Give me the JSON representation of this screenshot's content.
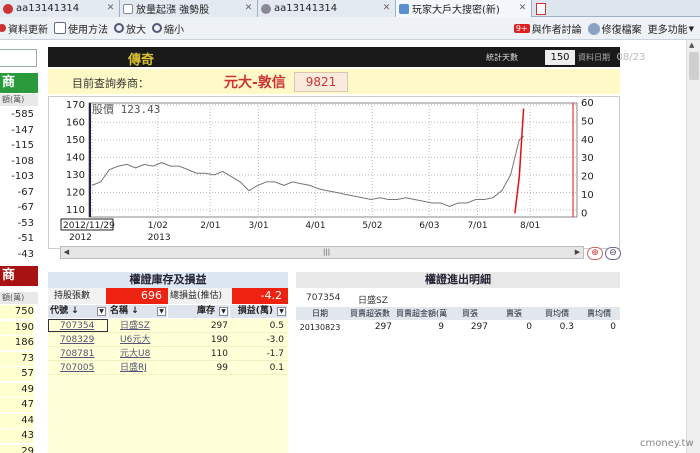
{
  "tabs": [
    {
      "label": "aa13141314",
      "active": false
    },
    {
      "label": "放量起漲 強勢股",
      "active": false
    },
    {
      "label": "aa13141314",
      "active": false
    },
    {
      "label": "玩家大戶大搜密(新)",
      "active": true
    }
  ],
  "toolbar": {
    "refresh": "資料更新",
    "help": "使用方法",
    "zoom_in": "放大",
    "zoom_out": "縮小",
    "badge": "9+",
    "discuss": "與作者討論",
    "repair": "修復檔案",
    "more": "更多功能"
  },
  "left": {
    "head1": "商",
    "sub1": "額(萬)",
    "vals1": [
      "-585",
      "-147",
      "-115",
      "-108",
      "-103",
      "-67",
      "-67",
      "-53",
      "-51",
      "-43"
    ],
    "head2": "商",
    "sub2": "額(萬)",
    "vals2": [
      "750",
      "190",
      "186",
      "73",
      "57",
      "49",
      "47",
      "44",
      "43",
      "29"
    ]
  },
  "header": {
    "title": "傳奇",
    "stat_label": "統計天數",
    "stat_value": "150",
    "date_label": "資料日期",
    "date_value": "08/23"
  },
  "query": {
    "label": "目前查詢券商：",
    "broker": "元大-敦信",
    "code": "9821"
  },
  "chart_data": {
    "type": "line",
    "title": "股價 123.43",
    "x_ticks": [
      "2012/11/29",
      "1/02",
      "2/01",
      "3/01",
      "4/01",
      "5/02",
      "6/03",
      "7/01",
      "8/01"
    ],
    "year_labels": [
      "2012",
      "2013"
    ],
    "y_left_ticks": [
      110,
      120,
      130,
      140,
      150,
      160,
      170
    ],
    "y_left_range": [
      106,
      171
    ],
    "y_right_ticks": [
      0,
      10,
      20,
      30,
      40,
      50,
      60
    ],
    "y_right_range": [
      -2,
      60
    ],
    "price_series": [
      [
        0,
        124
      ],
      [
        2,
        126
      ],
      [
        4,
        133
      ],
      [
        6,
        135
      ],
      [
        8,
        136
      ],
      [
        10,
        134
      ],
      [
        12,
        136
      ],
      [
        14,
        135
      ],
      [
        16,
        137
      ],
      [
        18,
        135
      ],
      [
        20,
        135
      ],
      [
        22,
        133
      ],
      [
        24,
        131
      ],
      [
        26,
        131
      ],
      [
        28,
        130
      ],
      [
        30,
        132
      ],
      [
        32,
        129
      ],
      [
        34,
        126
      ],
      [
        36,
        121
      ],
      [
        38,
        124
      ],
      [
        40,
        126
      ],
      [
        42,
        126
      ],
      [
        44,
        124
      ],
      [
        46,
        126
      ],
      [
        48,
        125
      ],
      [
        50,
        124
      ],
      [
        52,
        122
      ],
      [
        54,
        121
      ],
      [
        56,
        120
      ],
      [
        58,
        119
      ],
      [
        60,
        118
      ],
      [
        62,
        117
      ],
      [
        64,
        116
      ],
      [
        66,
        117
      ],
      [
        68,
        116
      ],
      [
        70,
        116
      ],
      [
        72,
        117
      ],
      [
        74,
        116
      ],
      [
        76,
        115
      ],
      [
        78,
        114
      ],
      [
        80,
        114
      ],
      [
        82,
        112
      ],
      [
        84,
        114
      ],
      [
        86,
        114
      ],
      [
        88,
        116
      ],
      [
        90,
        116
      ],
      [
        92,
        117
      ],
      [
        94,
        121
      ],
      [
        96,
        130
      ],
      [
        97,
        140
      ],
      [
        98,
        150
      ],
      [
        99,
        152
      ]
    ],
    "inventory_series": [
      [
        97,
        0
      ],
      [
        98,
        20
      ],
      [
        99,
        57
      ]
    ]
  },
  "inventory": {
    "title": "權證庫存及損益",
    "holdings_label": "持股張數",
    "holdings_value": "696",
    "pnl_label": "總損益(推估)",
    "pnl_value": "-4.2",
    "columns": [
      "代號 ↓",
      "名稱 ↓",
      "庫存",
      "損益(萬)"
    ],
    "rows": [
      {
        "code": "707354",
        "name": "日盛SZ",
        "qty": "297",
        "pnl": "0.5"
      },
      {
        "code": "708329",
        "name": "U6元大",
        "qty": "190",
        "pnl": "-3.0"
      },
      {
        "code": "708781",
        "name": "元大U8",
        "qty": "110",
        "pnl": "-1.7"
      },
      {
        "code": "707005",
        "name": "日盛RJ",
        "qty": "99",
        "pnl": "0.1"
      }
    ]
  },
  "detail": {
    "title": "權證進出明細",
    "code": "707354",
    "name": "日盛SZ",
    "columns": [
      "日期",
      "買賣超張數",
      "買賣超金額(萬)",
      "買張",
      "賣張",
      "買均價",
      "賣均價"
    ],
    "rows": [
      {
        "date": "20130823",
        "net_qty": "297",
        "net_amt": "9",
        "buy": "297",
        "sell": "0",
        "buy_avg": "0.3",
        "sell_avg": "0"
      }
    ]
  },
  "watermark": "cmoney.tw"
}
